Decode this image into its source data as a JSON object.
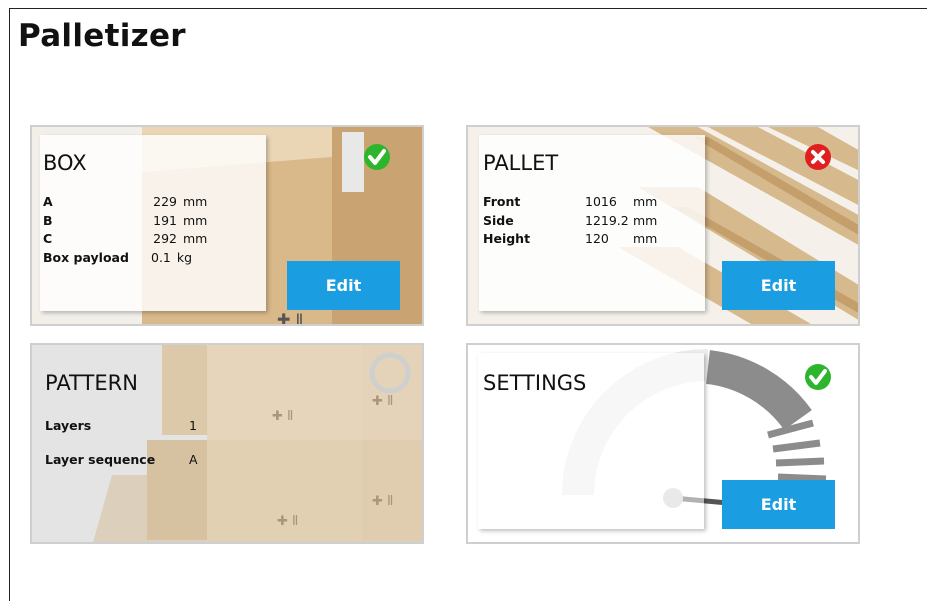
{
  "app": {
    "title": "Palletizer"
  },
  "colors": {
    "accent": "#1b9de2",
    "ok": "#2db52d",
    "error": "#e02020"
  },
  "box": {
    "title": "BOX",
    "status": "check-icon",
    "rows": [
      {
        "label": "A",
        "value": "229",
        "unit": "mm"
      },
      {
        "label": "B",
        "value": "191",
        "unit": "mm"
      },
      {
        "label": "C",
        "value": "292",
        "unit": "mm"
      },
      {
        "label": "Box payload",
        "value": "0.1",
        "unit": "kg"
      }
    ],
    "edit_label": "Edit"
  },
  "pallet": {
    "title": "PALLET",
    "status": "error-icon",
    "rows": [
      {
        "label": "Front",
        "value": "1016",
        "unit": "mm"
      },
      {
        "label": "Side",
        "value": "1219.2",
        "unit": "mm"
      },
      {
        "label": "Height",
        "value": "120",
        "unit": "mm"
      }
    ],
    "edit_label": "Edit"
  },
  "pattern": {
    "title": "PATTERN",
    "rows": [
      {
        "label": "Layers",
        "value": "1"
      },
      {
        "label": "Layer sequence",
        "value": "A"
      }
    ]
  },
  "settings": {
    "title": "SETTINGS",
    "status": "check-icon",
    "edit_label": "Edit"
  }
}
